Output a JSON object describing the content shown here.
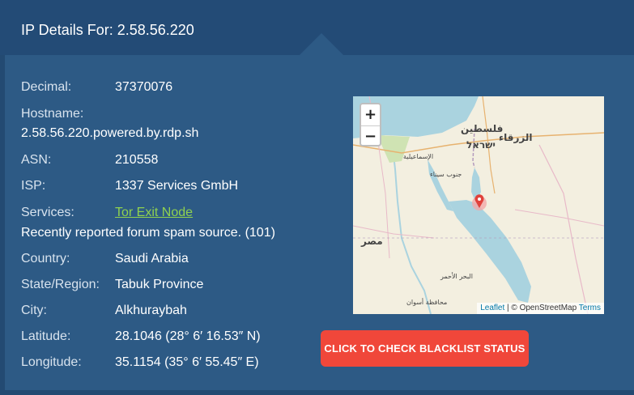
{
  "header": {
    "title": "IP Details For: 2.58.56.220"
  },
  "details": {
    "decimal_label": "Decimal:",
    "decimal_value": "37370076",
    "hostname_label": "Hostname:",
    "hostname_value": "2.58.56.220.powered.by.rdp.sh",
    "asn_label": "ASN:",
    "asn_value": "210558",
    "isp_label": "ISP:",
    "isp_value": "1337 Services GmbH",
    "services_label": "Services:",
    "services_link": "Tor Exit Node",
    "services_note": "Recently reported forum spam source. (101)",
    "country_label": "Country:",
    "country_value": "Saudi Arabia",
    "region_label": "State/Region:",
    "region_value": "Tabuk Province",
    "city_label": "City:",
    "city_value": "Alkhuraybah",
    "latitude_label": "Latitude:",
    "latitude_value": "28.1046 (28° 6′ 16.53″ N)",
    "longitude_label": "Longitude:",
    "longitude_value": "35.1154 (35° 6′ 55.45″ E)"
  },
  "map": {
    "zoom_in": "+",
    "zoom_out": "−",
    "attribution_leaflet": "Leaflet",
    "attribution_sep": " | © OpenStreetMap ",
    "attribution_terms": "Terms",
    "labels": {
      "palestine": "فلسطين",
      "israel": "ישראל",
      "zarqa": "الزرقاء",
      "egypt": "مصر",
      "ismailia": "الإسماعيلية",
      "south_sinai": "جنوب سيناء",
      "red_sea": "البحر الأحمر",
      "aswan": "محافظة أسوان"
    }
  },
  "actions": {
    "blacklist_button": "CLICK TO CHECK BLACKLIST STATUS"
  },
  "colors": {
    "background": "#234a72",
    "panel": "#2d5a85",
    "link": "#8fd14f",
    "button": "#f0473a"
  }
}
